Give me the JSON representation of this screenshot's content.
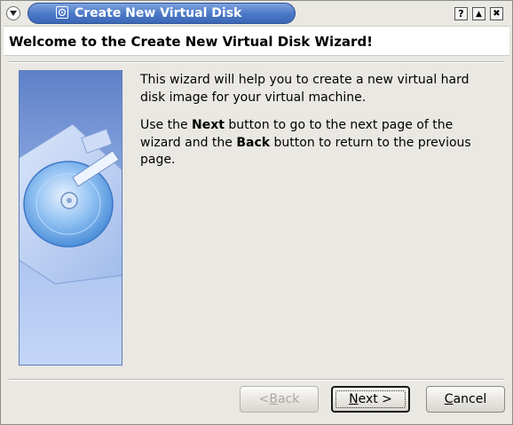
{
  "window": {
    "title": "Create New Virtual Disk",
    "controls": {
      "help": "?",
      "shade": "▲",
      "close": "✖"
    }
  },
  "header": {
    "title": "Welcome to the Create New Virtual Disk Wizard!"
  },
  "body": {
    "para1": "This wizard will help you to create a new virtual hard disk image for your virtual machine.",
    "para2_prefix": "Use the ",
    "para2_next": "Next",
    "para2_middle": " button to go to the next page of the wizard and the ",
    "para2_back": "Back",
    "para2_suffix": " button to return to the previous page."
  },
  "buttons": {
    "back": {
      "pre": "< ",
      "mnemonic": "B",
      "rest": "ack"
    },
    "next": {
      "mnemonic": "N",
      "rest": "ext >"
    },
    "cancel": {
      "mnemonic": "C",
      "rest": "ancel"
    }
  },
  "colors": {
    "titlebar_accent": "#4a78c6",
    "background": "#eae8e3",
    "header_bg": "#ffffff"
  },
  "icons": [
    "window-menu-icon",
    "app-icon",
    "help-icon",
    "shade-icon",
    "close-icon",
    "hard-disk-illustration"
  ]
}
